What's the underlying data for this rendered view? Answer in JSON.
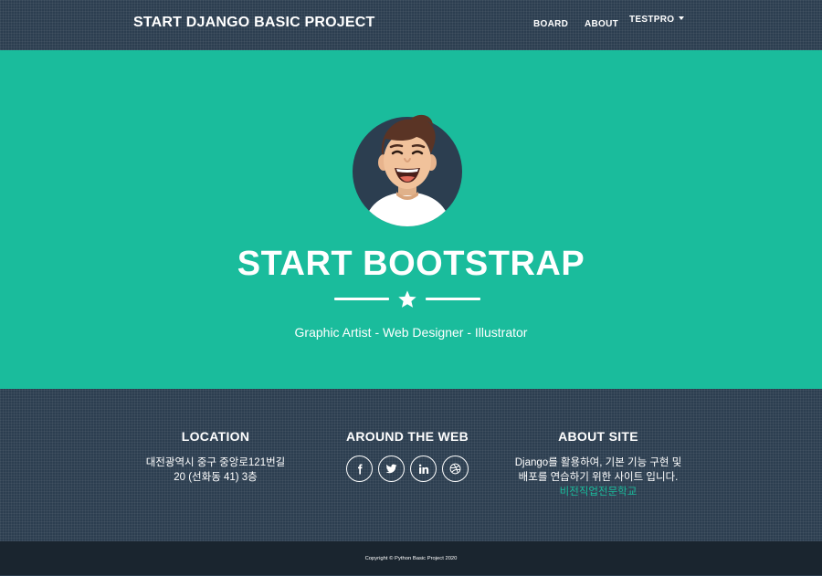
{
  "navbar": {
    "brand": "START DJANGO BASIC PROJECT",
    "links": [
      "BOARD",
      "ABOUT"
    ],
    "user_menu": "TESTPRO"
  },
  "masthead": {
    "avatar_icon": "avatar-illustration",
    "heading": "START BOOTSTRAP",
    "divider_icon": "star-icon",
    "subheading": "Graphic Artist - Web Designer - Illustrator"
  },
  "footer": {
    "location": {
      "title": "LOCATION",
      "line1": "대전광역시 중구 중앙로121번길",
      "line2": "20 (선화동 41) 3층"
    },
    "web": {
      "title": "AROUND THE WEB",
      "social_icons": [
        "facebook-icon",
        "twitter-icon",
        "linkedin-icon",
        "dribbble-icon"
      ]
    },
    "about": {
      "title": "ABOUT SITE",
      "line1": "Django를 활용하여, 기본 기능 구현 및",
      "line2": "배포를 연습하기 위한 사이트 입니다.",
      "link": "비전직업전문학교"
    }
  },
  "copyright": "Copyright © Python Basic Project 2020",
  "colors": {
    "primary": "#2c3e50",
    "accent": "#1abc9c",
    "dark": "#1a252f",
    "text": "#ffffff"
  }
}
